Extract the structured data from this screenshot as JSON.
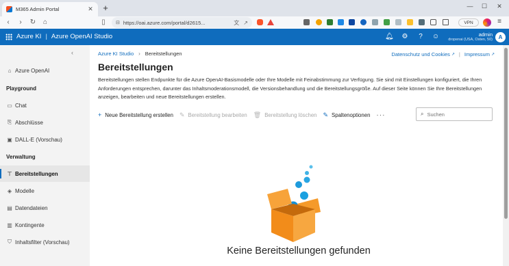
{
  "browser": {
    "tab_title": "M365 Admin Portal",
    "url": "https://oai.azure.com/portal/d2615...",
    "vpn_label": "VPN"
  },
  "app": {
    "product": "Azure KI",
    "studio": "Azure OpenAI Studio",
    "user_name": "admin",
    "user_tenant": "dropenai (USA, Osten, 50)",
    "avatar_initial": "A",
    "accent_color": "#0f6cbd"
  },
  "sidebar": {
    "top_item": "Azure OpenAI",
    "sections": [
      {
        "title": "Playground",
        "items": [
          "Chat",
          "Abschlüsse",
          "DALL-E (Vorschau)"
        ]
      },
      {
        "title": "Verwaltung",
        "items": [
          "Bereitstellungen",
          "Modelle",
          "Datendateien",
          "Kontingente",
          "Inhaltsfilter (Vorschau)"
        ]
      }
    ],
    "active_item": "Bereitstellungen"
  },
  "breadcrumb": [
    "Azure KI Studio",
    "Bereitstellungen"
  ],
  "top_links": [
    "Datenschutz und Cookies",
    "Impressum"
  ],
  "page": {
    "title": "Bereitstellungen",
    "description": "Bereitstellungen stellen Endpunkte für die Azure OpenAI-Basismodelle oder Ihre Modelle mit Feinabstimmung zur Verfügung. Sie sind mit Einstellungen konfiguriert, die Ihren Anforderungen entsprechen, darunter das Inhaltsmoderationsmodell, die Versionsbehandlung und die Bereitstellungsgröße. Auf dieser Seite können Sie Ihre Bereitstellungen anzeigen, bearbeiten und neue Bereitstellungen erstellen."
  },
  "commands": {
    "create": "Neue Bereitstellung erstellen",
    "edit": "Bereitstellung bearbeiten",
    "delete": "Bereitstellung löschen",
    "columns": "Spaltenoptionen",
    "more": "···"
  },
  "search": {
    "placeholder": "Suchen"
  },
  "empty_state": {
    "title": "Keine Bereitstellungen gefunden"
  }
}
